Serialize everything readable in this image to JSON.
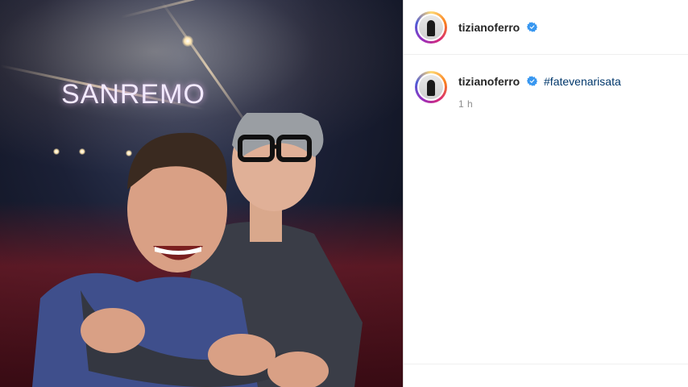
{
  "photo": {
    "stage_sign": "SANREMO"
  },
  "post": {
    "header": {
      "username": "tizianoferro",
      "verified": true
    },
    "caption": {
      "username": "tizianoferro",
      "hashtag": "#fatevenarisata",
      "time": "1 h"
    }
  },
  "colors": {
    "link": "#00376b",
    "verified": "#3897f0",
    "text": "#262626",
    "muted": "#8e8e8e"
  },
  "icons": {
    "verified": "verified-badge-icon"
  }
}
